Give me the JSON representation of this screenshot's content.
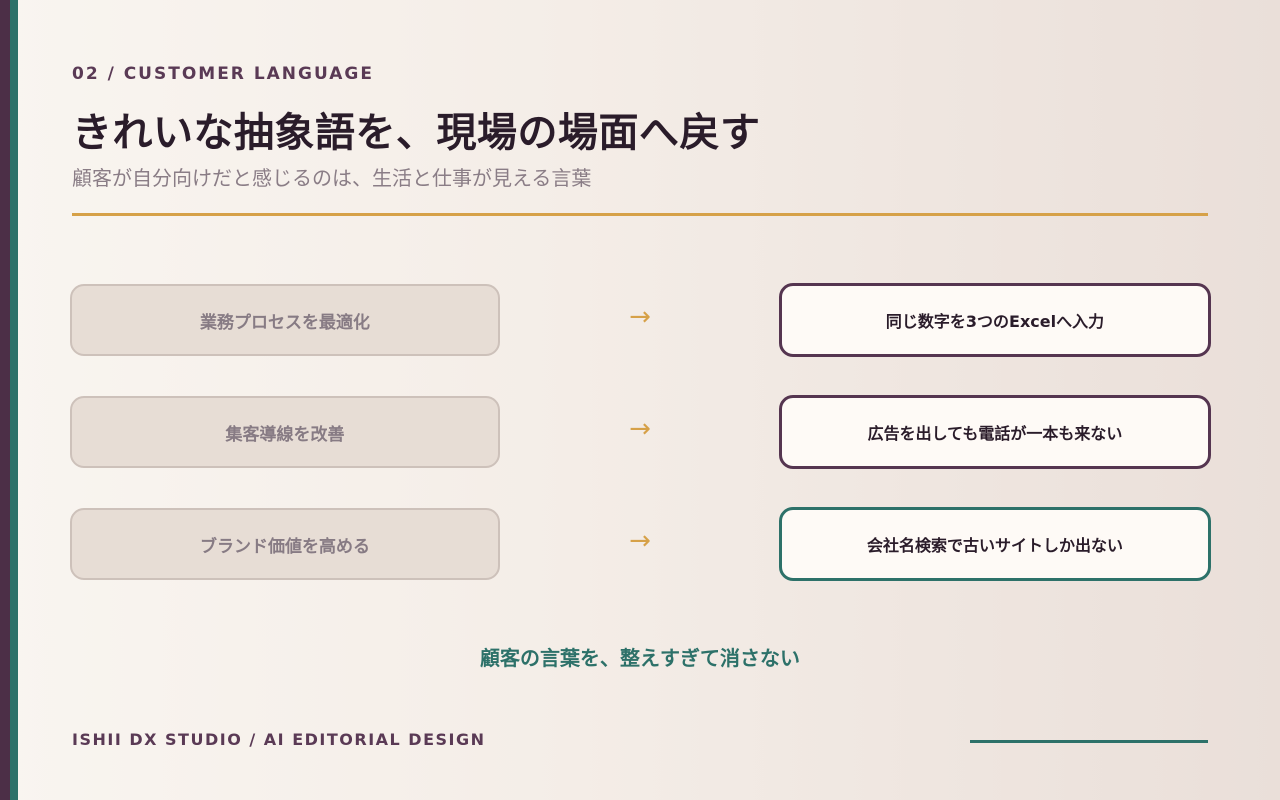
{
  "header": {
    "eyebrow": "02 / CUSTOMER LANGUAGE",
    "title": "きれいな抽象語を、現場の場面へ戻す",
    "subtitle": "顧客が自分向けだと感じるのは、生活と仕事が見える言葉"
  },
  "rows": [
    {
      "before": "業務プロセスを最適化",
      "arrow": "→",
      "after": "同じ数字を3つのExcelへ入力"
    },
    {
      "before": "集客導線を改善",
      "arrow": "→",
      "after": "広告を出しても電話が一本も来ない"
    },
    {
      "before": "ブランド価値を高める",
      "arrow": "→",
      "after": "会社名検索で古いサイトしか出ない"
    }
  ],
  "closing": "顧客の言葉を、整えすぎて消さない",
  "footer": {
    "text": "ISHII DX STUDIO / AI EDITORIAL DESIGN"
  },
  "colors": {
    "plum": "#553550",
    "teal": "#2d7169",
    "gold": "#d6a148",
    "muted_box": "#e7ddd5"
  }
}
